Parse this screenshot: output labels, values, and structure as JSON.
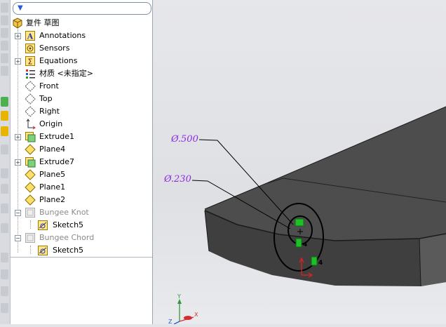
{
  "feature_tree": {
    "filter_icon": "filter-icon",
    "root_label": "复件 草图",
    "items": [
      {
        "label": "Annotations",
        "icon": "annotations-icon",
        "expandable": true
      },
      {
        "label": "Sensors",
        "icon": "sensors-icon",
        "expandable": false
      },
      {
        "label": "Equations",
        "icon": "equations-icon",
        "expandable": true
      },
      {
        "label": "材质 <未指定>",
        "icon": "material-icon",
        "expandable": false
      },
      {
        "label": "Front",
        "icon": "plane-icon",
        "expandable": false
      },
      {
        "label": "Top",
        "icon": "plane-icon",
        "expandable": false
      },
      {
        "label": "Right",
        "icon": "plane-icon",
        "expandable": false
      },
      {
        "label": "Origin",
        "icon": "origin-icon",
        "expandable": false
      },
      {
        "label": "Extrude1",
        "icon": "extrude-icon",
        "expandable": true
      },
      {
        "label": "Plane4",
        "icon": "plane-icon",
        "expandable": false
      },
      {
        "label": "Extrude7",
        "icon": "extrude-icon",
        "expandable": true
      },
      {
        "label": "Plane5",
        "icon": "plane-icon",
        "expandable": false
      },
      {
        "label": "Plane1",
        "icon": "plane-icon",
        "expandable": false
      },
      {
        "label": "Plane2",
        "icon": "plane-icon",
        "expandable": false
      },
      {
        "label": "Bungee Knot",
        "icon": "folder-icon",
        "expandable": true,
        "suppressed": true
      },
      {
        "label": "Sketch5",
        "icon": "sketch-icon",
        "expandable": false,
        "child": true
      },
      {
        "label": "Bungee Chord",
        "icon": "folder-icon",
        "expandable": true,
        "suppressed": true
      },
      {
        "label": "Sketch5",
        "icon": "sketch-icon",
        "expandable": false,
        "child": true
      }
    ]
  },
  "viewport": {
    "dimensions": [
      {
        "text": "Ø.500"
      },
      {
        "text": "Ø.230"
      }
    ],
    "relation_markers": [
      "4",
      "4"
    ],
    "triad_axes": [
      "Y",
      "X",
      "Z"
    ]
  },
  "colors": {
    "dimension": "#8a2be2",
    "part_face_top": "#4d4d4d",
    "part_face_front": "#3e3e3e",
    "relation_marker": "#1fbf2a"
  }
}
